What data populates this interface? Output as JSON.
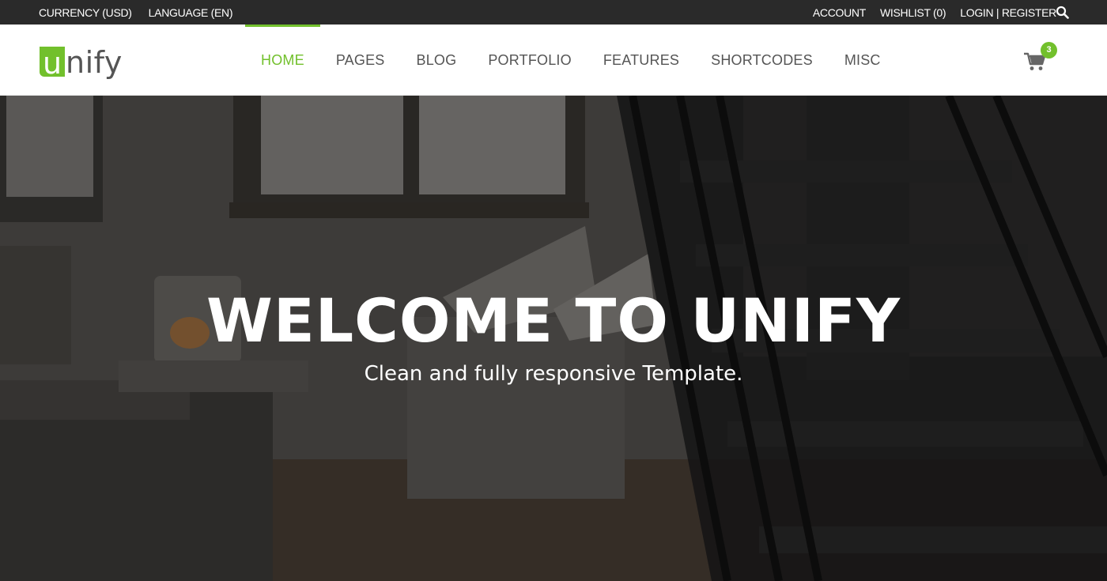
{
  "topbar": {
    "currency": "CURRENCY (USD)",
    "language": "LANGUAGE (EN)",
    "account": "ACCOUNT",
    "wishlist": "WISHLIST (0)",
    "login_register": "LOGIN | REGISTER"
  },
  "logo": {
    "first_letter": "u",
    "rest": "nify"
  },
  "nav": {
    "items": [
      {
        "label": "HOME"
      },
      {
        "label": "PAGES"
      },
      {
        "label": "BLOG"
      },
      {
        "label": "PORTFOLIO"
      },
      {
        "label": "FEATURES"
      },
      {
        "label": "SHORTCODES"
      },
      {
        "label": "MISC"
      }
    ]
  },
  "cart": {
    "count": "3",
    "icon": "shopping-cart-icon"
  },
  "hero": {
    "title": "WELCOME TO UNIFY",
    "subtitle": "Clean and fully responsive Template."
  },
  "colors": {
    "accent": "#72c02c",
    "topbar_bg": "#2a2a2a",
    "nav_text": "#555555"
  }
}
